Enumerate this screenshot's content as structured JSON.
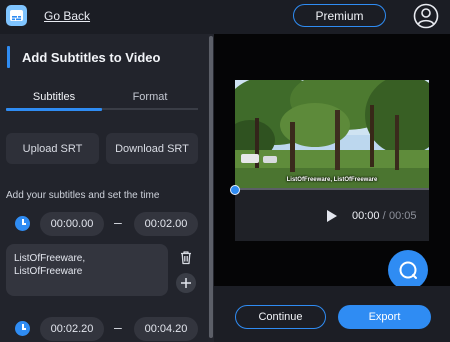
{
  "header": {
    "logo_icon": "video-subtitle-app-icon",
    "go_back_label": "Go Back",
    "premium_label": "Premium",
    "profile_icon": "user-circle-icon"
  },
  "panel": {
    "title": "Add Subtitles to Video",
    "tabs": [
      {
        "label": "Subtitles",
        "active": true
      },
      {
        "label": "Format",
        "active": false
      }
    ],
    "upload_label": "Upload SRT",
    "download_label": "Download SRT",
    "hint": "Add your subtitles and set the time",
    "subtitles": [
      {
        "start": "00:00.00",
        "end": "00:02.00",
        "text": "ListOfFreeware,\nListOfFreeware"
      },
      {
        "start": "00:02.20",
        "end": "00:04.20",
        "text": ""
      }
    ],
    "dash": "–"
  },
  "player": {
    "caption": "ListOfFreeware, ListOfFreeware",
    "current_time": "00:00",
    "separator": " / ",
    "total_time": "00:05",
    "progress": 0
  },
  "footer": {
    "continue_label": "Continue",
    "export_label": "Export"
  },
  "colors": {
    "accent": "#2f8cf3",
    "background": "#1d1f26",
    "panel": "#22242c",
    "control": "#33353e"
  }
}
